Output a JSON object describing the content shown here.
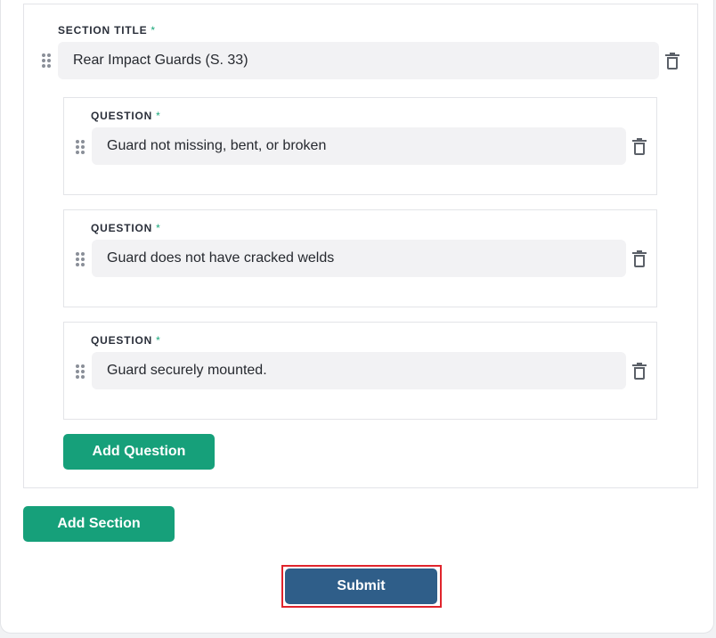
{
  "section": {
    "title_label": "SECTION TITLE",
    "required_mark": "*",
    "title_value": "Rear Impact Guards (S. 33)",
    "questions": [
      {
        "label": "QUESTION",
        "required_mark": "*",
        "value": "Guard not missing, bent, or broken"
      },
      {
        "label": "QUESTION",
        "required_mark": "*",
        "value": "Guard does not have cracked welds"
      },
      {
        "label": "QUESTION",
        "required_mark": "*",
        "value": "Guard securely mounted."
      }
    ],
    "add_question_label": "Add Question"
  },
  "actions": {
    "add_section_label": "Add Section",
    "submit_label": "Submit"
  },
  "colors": {
    "accent_green": "#16a07a",
    "submit_blue": "#2f5e89",
    "required_green": "#1aa67a",
    "highlight_red": "#e0242c"
  },
  "icons": {
    "drag": "drag-handle-icon",
    "delete": "trash-icon"
  }
}
